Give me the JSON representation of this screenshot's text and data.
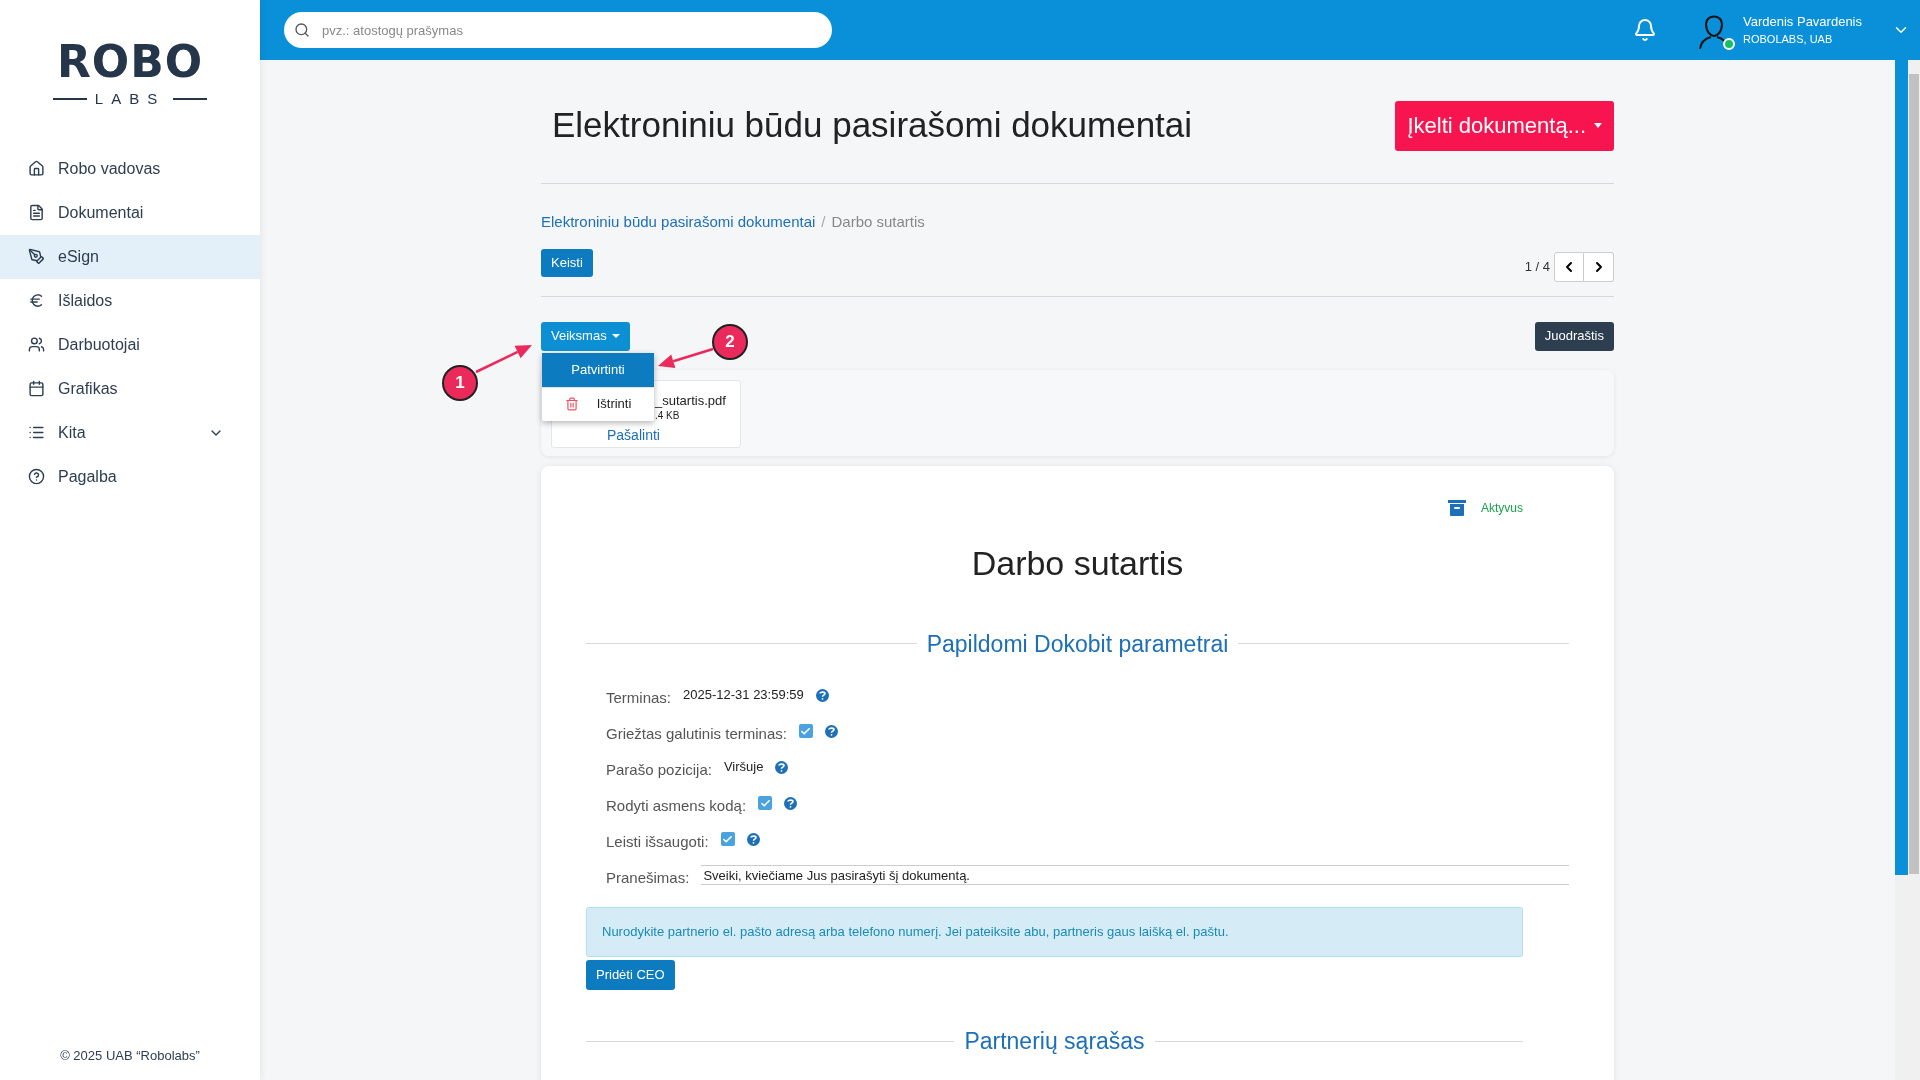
{
  "sidebar": {
    "logo": {
      "top": "ROBO",
      "bottom": "LABS"
    },
    "items": [
      {
        "label": "Robo vadovas",
        "kind": "link",
        "selected": false
      },
      {
        "label": "Dokumentai",
        "kind": "link",
        "selected": false
      },
      {
        "label": "eSign",
        "kind": "link",
        "selected": true
      },
      {
        "label": "Išlaidos",
        "kind": "link",
        "selected": false
      },
      {
        "label": "Darbuotojai",
        "kind": "link",
        "selected": false
      },
      {
        "label": "Grafikas",
        "kind": "link",
        "selected": false
      },
      {
        "label": "Kita",
        "kind": "group",
        "selected": false
      },
      {
        "label": "Pagalba",
        "kind": "link",
        "selected": false
      }
    ],
    "footer": "© 2025 UAB “Robolabs”"
  },
  "topbar": {
    "search": {
      "placeholder": "pvz.: atostogų prašymas"
    },
    "user": {
      "name": "Vardenis Pavardenis",
      "company": "ROBOLABS, UAB",
      "online": true
    }
  },
  "page": {
    "title": "Elektroniniu būdu pasirašomi dokumentai",
    "upload_button": "Įkelti dokumentą...",
    "breadcrumb": [
      "Elektroniniu būdu pasirašomi dokumentai",
      "Darbo sutartis"
    ],
    "breadcrumb_separator": "/",
    "edit_button": "Keisti",
    "pager": "1 / 4",
    "actions_button": "Veiksmas",
    "actions_menu": [
      {
        "label": "Patvirtinti",
        "selected": true
      },
      {
        "label": "Ištrinti",
        "selected": false
      }
    ],
    "status_button": "Juodraštis",
    "attachment": {
      "name": "_sutartis.pdf",
      "size": ".4 KB",
      "remove": "Pašalinti"
    }
  },
  "document": {
    "status": "Aktyvus",
    "title": "Darbo sutartis",
    "section_title": "Papildomi Dokobit parametrai",
    "fields": [
      {
        "kind": "text",
        "label": "Terminas:",
        "value": "2025-12-31 23:59:59"
      },
      {
        "kind": "checkbox",
        "label": "Griežtas galutinis terminas:",
        "checked": true
      },
      {
        "kind": "text",
        "label": "Parašo pozicija:",
        "value": "Viršuje"
      },
      {
        "kind": "checkbox",
        "label": "Rodyti asmens kodą:",
        "checked": true
      },
      {
        "kind": "checkbox",
        "label": "Leisti išsaugoti:",
        "checked": true
      },
      {
        "kind": "input",
        "label": "Pranešimas:",
        "value": "Sveiki, kviečiame Jus pasirašyti šį dokumentą."
      }
    ],
    "info": "Nurodykite partnerio el. pašto adresą arba telefono numerį. Jei pateiksite abu, partneris gaus laišką el. paštu.",
    "add_ceo_button": "Pridėti CEO",
    "partners_title": "Partnerių sąrašas"
  },
  "annotations": [
    {
      "label": "1"
    },
    {
      "label": "2"
    }
  ]
}
